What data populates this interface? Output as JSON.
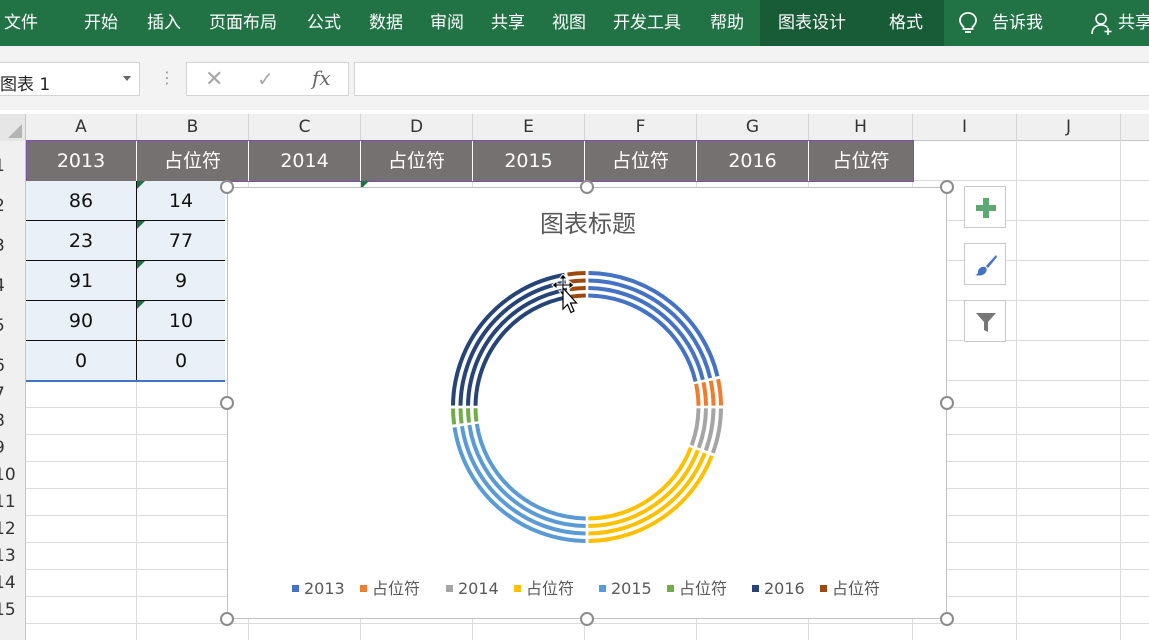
{
  "ribbon": {
    "tabs": [
      "文件",
      "开始",
      "插入",
      "页面布局",
      "公式",
      "数据",
      "审阅",
      "共享",
      "视图",
      "开发工具",
      "帮助",
      "图表设计",
      "格式"
    ],
    "tell_me": "告诉我",
    "share": "共享"
  },
  "formula_bar": {
    "name_box": "图表 1",
    "cancel_icon": "✕",
    "enter_icon": "✓",
    "fx_label": "fx",
    "formula": ""
  },
  "columns": [
    "A",
    "B",
    "C",
    "D",
    "E",
    "F",
    "G",
    "H",
    "I",
    "J"
  ],
  "rows": [
    "1",
    "2",
    "3",
    "4",
    "5",
    "6",
    "7",
    "8",
    "9",
    "10",
    "11",
    "12",
    "13",
    "14",
    "15"
  ],
  "header_row": [
    "2013",
    "占位符",
    "2014",
    "占位符",
    "2015",
    "占位符",
    "2016",
    "占位符"
  ],
  "table": [
    [
      "86",
      "14"
    ],
    [
      "23",
      "77"
    ],
    [
      "91",
      "9"
    ],
    [
      "90",
      "10"
    ],
    [
      "0",
      "0"
    ]
  ],
  "chart": {
    "title": "图表标题",
    "legend": [
      "2013",
      "占位符",
      "2014",
      "占位符",
      "2015",
      "占位符",
      "2016",
      "占位符"
    ],
    "colors": [
      "#4472c4",
      "#ed7d31",
      "#a5a5a5",
      "#ffc000",
      "#5b9bd5",
      "#70ad47",
      "#264478",
      "#9e480e"
    ]
  },
  "chart_data": {
    "type": "donut",
    "title": "图表标题",
    "categories": [
      "2013",
      "占位符",
      "2014",
      "占位符",
      "2015",
      "占位符",
      "2016",
      "占位符"
    ],
    "series": [
      {
        "values": [
          86,
          14,
          23,
          77,
          91,
          9,
          90,
          10
        ]
      },
      {
        "values": [
          86,
          14,
          23,
          77,
          91,
          9,
          90,
          10
        ]
      },
      {
        "values": [
          86,
          14,
          23,
          77,
          91,
          9,
          90,
          10
        ]
      },
      {
        "values": [
          86,
          14,
          23,
          77,
          91,
          9,
          90,
          10
        ]
      },
      {
        "values": [
          0,
          0,
          0,
          0,
          0,
          0,
          0,
          0
        ]
      }
    ],
    "legend_position": "bottom"
  }
}
